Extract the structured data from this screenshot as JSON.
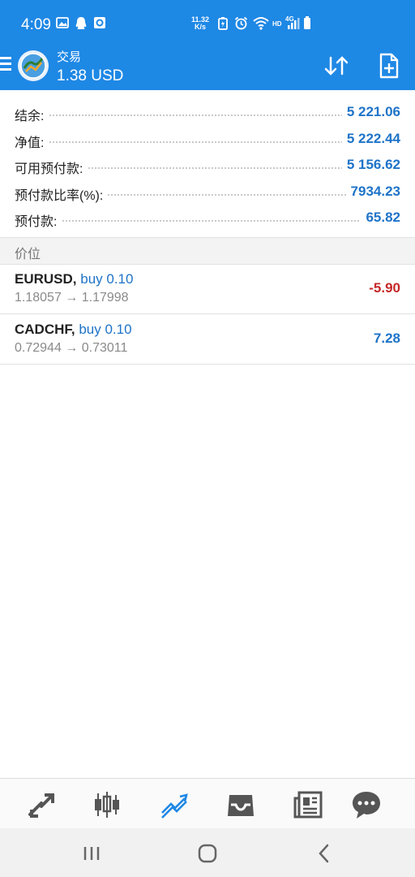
{
  "status_bar": {
    "time": "4:09",
    "net_speed_value": "11.32",
    "net_speed_unit": "K/s",
    "network_label": "HD",
    "network_type": "4G"
  },
  "header": {
    "title": "交易",
    "balance": "1.38 USD",
    "icons": [
      "menu-icon",
      "app-logo",
      "sort-icon",
      "new-order-icon"
    ]
  },
  "summary": [
    {
      "label": "结余:",
      "value": "5 221.06"
    },
    {
      "label": "净值:",
      "value": "5 222.44"
    },
    {
      "label": "可用预付款:",
      "value": "5 156.62"
    },
    {
      "label": "预付款比率(%):",
      "value": "7934.23"
    },
    {
      "label": "预付款:",
      "value": "65.82"
    }
  ],
  "section_title": "价位",
  "positions": [
    {
      "symbol": "EURUSD,",
      "direction": "buy 0.10",
      "prices": "1.18057 → 1.17998",
      "profit": "-5.90"
    },
    {
      "symbol": "CADCHF,",
      "direction": "buy 0.10",
      "prices": "0.72944 → 0.73011",
      "profit": "7.28"
    }
  ],
  "bottom_tabs": [
    "quotes-icon",
    "chart-icon",
    "trade-icon",
    "history-icon",
    "news-icon",
    "chat-icon"
  ],
  "active_tab": "trade-icon",
  "colors": {
    "accent": "#1e88e5",
    "value_blue": "#1e73c8",
    "loss_red": "#c62828"
  }
}
